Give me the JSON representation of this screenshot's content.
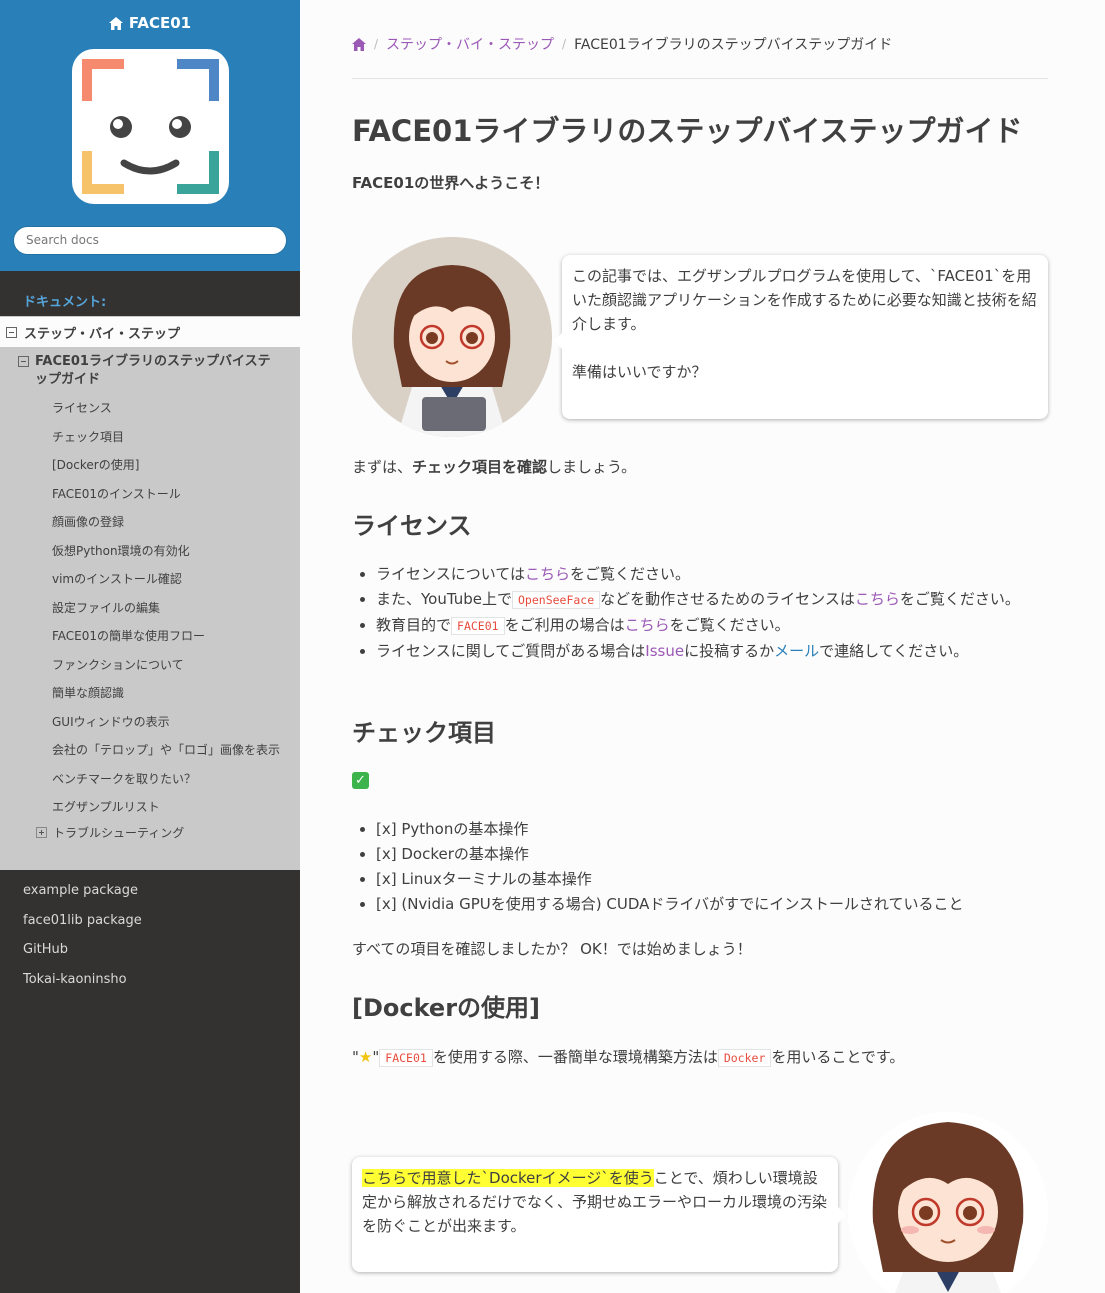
{
  "sidebar": {
    "project_name": "FACE01",
    "search_placeholder": "Search docs",
    "caption": "ドキュメント:",
    "l1_current": "ステップ・バイ・ステップ",
    "l2_current": "FACE01ライブラリのステップバイステップガイド",
    "l3_items": [
      "ライセンス",
      "チェック項目",
      "[Dockerの使用]",
      "FACE01のインストール",
      "顔画像の登録",
      "仮想Python環境の有効化",
      "vimのインストール確認",
      "設定ファイルの編集",
      "FACE01の簡単な使用フロー",
      "ファンクションについて",
      "簡単な顔認識",
      "GUIウィンドウの表示",
      "会社の「テロップ」や「ロゴ」画像を表示",
      "ベンチマークを取りたい？",
      "エグザンプルリスト"
    ],
    "l3_trouble": "トラブルシューティング",
    "l1_items": [
      "example package",
      "face01lib package",
      "GitHub",
      "Tokai-kaoninsho"
    ]
  },
  "breadcrumbs": {
    "section": "ステップ・バイ・ステップ",
    "sep": "/",
    "current": "FACE01ライブラリのステップバイステップガイド"
  },
  "page": {
    "title": "FACE01ライブラリのステップバイステップガイド",
    "welcome": "FACE01の世界へようこそ！",
    "bubble1_text": "この記事では、エグザンプルプログラムを使用して、`FACE01`を用いた顔認識アプリケーションを作成するために必要な知識と技術を紹介します。",
    "bubble1_ready": "準備はいいですか？",
    "first_pre": "まずは、",
    "first_bold": "チェック項目を確認",
    "first_post": "しましょう。",
    "license_heading": "ライセンス",
    "license": {
      "l1_pre": "ライセンスについては",
      "l1_link": "こちら",
      "l1_post": "をご覧ください。",
      "l2_pre": "また、YouTube上で",
      "l2_code": "OpenSeeFace",
      "l2_mid": "などを動作させるためのライセンスは",
      "l2_link": "こちら",
      "l2_post": "をご覧ください。",
      "l3_pre": "教育目的で",
      "l3_code": "FACE01",
      "l3_mid": "をご利用の場合は",
      "l3_link": "こちら",
      "l3_post": "をご覧ください。",
      "l4_pre": "ライセンスに関してご質問がある場合は",
      "l4_link1": "Issue",
      "l4_mid": "に投稿するか",
      "l4_link2": "メール",
      "l4_post": "で連絡してください。"
    },
    "check_heading": "チェック項目",
    "check_icon": "✓",
    "check_items": [
      "[x] Pythonの基本操作",
      "[x] Dockerの基本操作",
      "[x] Linuxターミナルの基本操作",
      "[x] (Nvidia GPUを使用する場合) CUDAドライバがすでにインストールされていること"
    ],
    "all_checked": "すべての項目を確認しましたか？ OK！では始めましょう！",
    "docker_heading": "[Dockerの使用]",
    "docker": {
      "quote_open": "\"",
      "star": "★",
      "quote_close": "\"",
      "code1": "FACE01",
      "mid": "を使用する際、一番簡単な環境構築方法は",
      "code2": "Docker",
      "post": "を用いることです。"
    },
    "bubble2_hl": "こちらで用意した`Dockerイメージ`を使う",
    "bubble2_rest": "ことで、煩わしい環境設定から解放されるだけでなく、予期せぬエラーやローカル環境の汚染を防ぐことが出来ます。"
  },
  "colors": {
    "sidebar_top": "#2980b9",
    "sidebar_bg": "#343131",
    "link": "#9b59b6",
    "code": "#e74c3c",
    "highlight": "#ffff33"
  }
}
